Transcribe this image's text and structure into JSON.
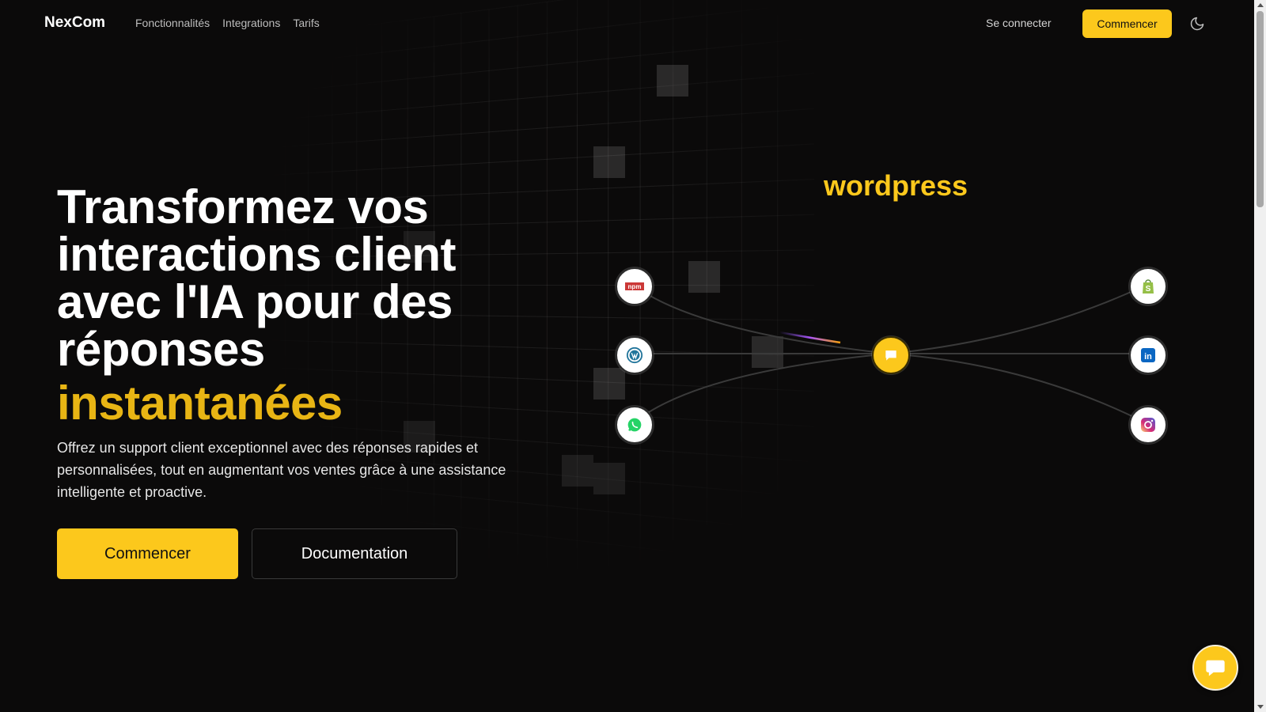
{
  "header": {
    "brand": "NexCom",
    "nav": [
      "Fonctionnalités",
      "Integrations",
      "Tarifs"
    ],
    "login": "Se connecter",
    "cta": "Commencer",
    "theme_icon": "moon-icon"
  },
  "hero": {
    "title": "Transformez vos interactions client avec l'IA pour des réponses",
    "title_accent": "instantanées",
    "subtitle": "Offrez un support client exceptionnel avec des réponses rapides et personnalisées, tout en augmentant vos ventes grâce à une assistance intelligente et proactive.",
    "primary_button": "Commencer",
    "secondary_button": "Documentation"
  },
  "integrations": {
    "active_label": "wordpress",
    "left_nodes": [
      "npm-icon",
      "wordpress-icon",
      "whatsapp-icon"
    ],
    "hub": "chat-icon",
    "right_nodes": [
      "shopify-icon",
      "linkedin-icon",
      "instagram-icon"
    ]
  },
  "chat_widget": {
    "icon": "chat-bubble-icon"
  },
  "colors": {
    "accent": "#fcc81c",
    "background": "#0b0a0a",
    "accent_text": "#e8b514"
  }
}
